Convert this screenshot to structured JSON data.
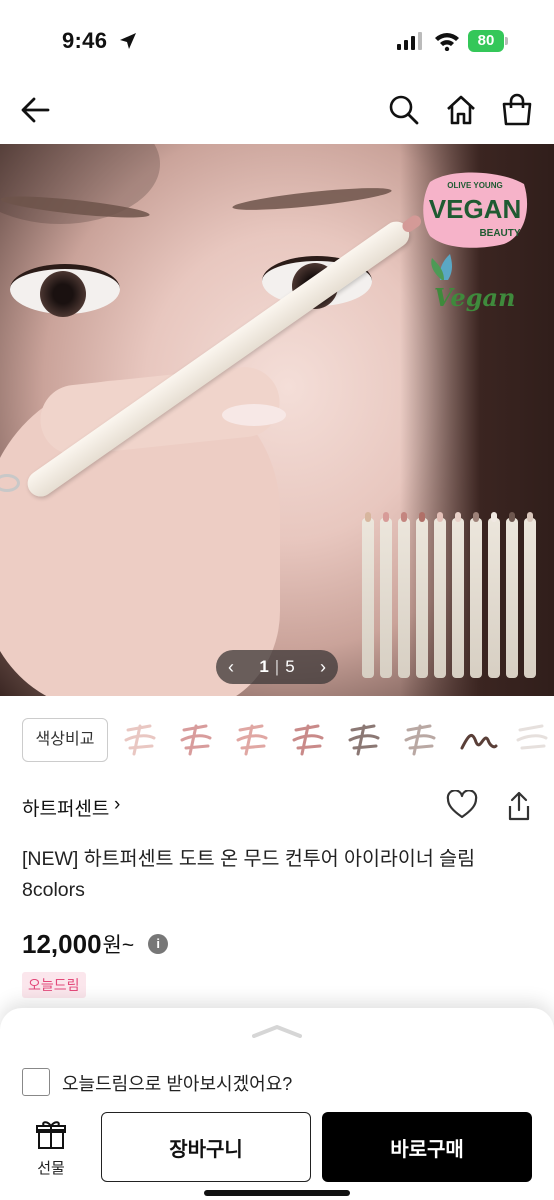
{
  "status_bar": {
    "time": "9:46",
    "battery": "80",
    "battery_color": "#34c759"
  },
  "nav": {
    "icons": [
      "back-arrow-icon",
      "search-icon",
      "home-icon",
      "shopping-bag-icon"
    ]
  },
  "hero": {
    "badge_line1": "OLIVE YOUNG",
    "badge_main": "VEGAN",
    "badge_line2": "BEAUTY",
    "badge_script": "Vegan",
    "pager_current": "1",
    "pager_total": "5",
    "pager_prev_icon": "chevron-left-icon",
    "pager_next_icon": "chevron-right-icon"
  },
  "color_compare": {
    "label": "색상비교",
    "swatches": [
      {
        "color": "#e9c7c2"
      },
      {
        "color": "#d89c9c"
      },
      {
        "color": "#e0a7a3"
      },
      {
        "color": "#c98a89"
      },
      {
        "color": "#8b7874"
      },
      {
        "color": "#b9a8a3"
      },
      {
        "color": "#5a3f38"
      },
      {
        "color": "#e6e0dd"
      }
    ]
  },
  "product": {
    "brand": "하트퍼센트",
    "title": "[NEW] 하트퍼센트 도트 온 무드 컨투어 아이라이너 슬림 8colors",
    "price": "12,000",
    "price_unit": "원~",
    "tag": "오늘드림",
    "tag_color": "#e3497a"
  },
  "sheet": {
    "checkbox_label": "오늘드림으로 받아보시겠어요?",
    "gift_label": "선물",
    "cart_label": "장바구니",
    "buy_label": "바로구매"
  }
}
